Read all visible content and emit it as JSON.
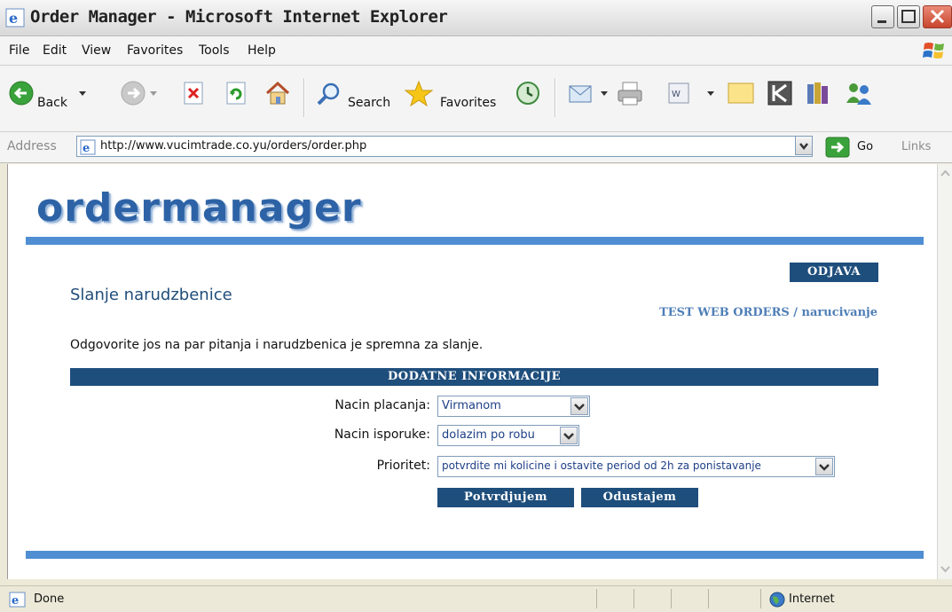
{
  "window": {
    "title": "Order Manager - Microsoft Internet Explorer"
  },
  "menu": {
    "items": [
      "File",
      "Edit",
      "View",
      "Favorites",
      "Tools",
      "Help"
    ]
  },
  "toolbar": {
    "back_label": "Back",
    "search_label": "Search",
    "favorites_label": "Favorites"
  },
  "address": {
    "label": "Address",
    "url": "http://www.vucimtrade.co.yu/orders/order.php",
    "go_label": "Go",
    "links_label": "Links"
  },
  "page": {
    "logo": "ordermanager",
    "logout_label": "ODJAVA",
    "heading": "Slanje narudzbenice",
    "company_line": "TEST WEB ORDERS / narucivanje",
    "intro": "Odgovorite jos na par pitanja i narudzbenica je spremna za slanje.",
    "section_title": "DODATNE INFORMACIJE",
    "fields": {
      "payment": {
        "label": "Nacin placanja:",
        "value": "Virmanom"
      },
      "delivery": {
        "label": "Nacin isporuke:",
        "value": "dolazim po robu"
      },
      "priority": {
        "label": "Prioritet:",
        "value": "potvrdite mi kolicine i ostavite period od 2h za ponistavanje"
      }
    },
    "confirm_label": "Potvrdjujem",
    "cancel_label": "Odustajem"
  },
  "status": {
    "text": "Done",
    "zone": "Internet"
  }
}
